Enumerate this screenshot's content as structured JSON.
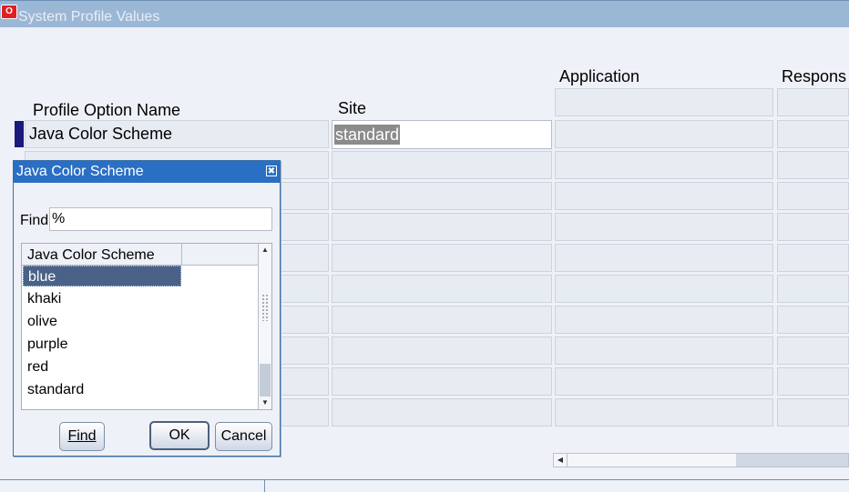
{
  "window": {
    "title": "System Profile Values",
    "app_icon": "oracle-icon"
  },
  "columns": {
    "profile_option_name": "Profile Option Name",
    "site": "Site",
    "application": "Application",
    "responsibility": "Respons"
  },
  "rows": [
    {
      "name": "Java Color Scheme",
      "site": "standard"
    }
  ],
  "dialog": {
    "title": "Java Color Scheme",
    "close_icon": "close-icon",
    "find_label": "Find",
    "find_value": "%",
    "list_header": "Java Color Scheme",
    "items": [
      "blue",
      "khaki",
      "olive",
      "purple",
      "red",
      "standard"
    ],
    "selected": "blue",
    "buttons": {
      "find": "Find",
      "ok": "OK",
      "cancel": "Cancel"
    }
  },
  "colors": {
    "titlebar": "#9bb7d6",
    "dialog_title": "#2a6fc4",
    "selection": "#4a6288",
    "row_marker": "#1a1a7a"
  }
}
